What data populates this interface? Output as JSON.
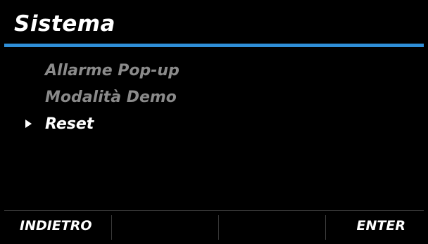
{
  "header": {
    "title": "Sistema"
  },
  "menu": {
    "items": [
      {
        "label": "Allarme Pop-up",
        "state": "disabled"
      },
      {
        "label": "Modalità Demo",
        "state": "disabled"
      },
      {
        "label": "Reset",
        "state": "selected"
      }
    ]
  },
  "softkeys": {
    "left": "INDIETRO",
    "center_left": "",
    "center_right": "",
    "right": "ENTER"
  },
  "colors": {
    "background": "#000000",
    "accent_rule": "#2f8fd8",
    "text_active": "#ffffff",
    "text_dim": "#8a8a8a"
  },
  "icons": {
    "cursor": "triangle-right-icon"
  }
}
